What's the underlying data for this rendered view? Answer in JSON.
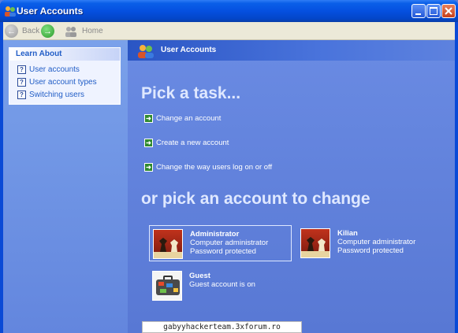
{
  "window": {
    "title": "User Accounts",
    "buttons": {
      "minimize": "minimize",
      "maximize": "maximize",
      "close": "close"
    }
  },
  "toolbar": {
    "back_label": "Back",
    "home_label": "Home"
  },
  "sidebar": {
    "heading": "Learn About",
    "items": [
      {
        "label": "User accounts"
      },
      {
        "label": "User account types"
      },
      {
        "label": "Switching users"
      }
    ]
  },
  "main": {
    "header_title": "User Accounts",
    "pick_task": "Pick a task...",
    "tasks": [
      {
        "label": "Change an account"
      },
      {
        "label": "Create a new account"
      },
      {
        "label": "Change the way users log on or off"
      }
    ],
    "pick_account": "or pick an account to change",
    "accounts": [
      {
        "name": "Administrator",
        "type": "Computer administrator",
        "status": "Password protected",
        "picture": "chess-icon"
      },
      {
        "name": "Kilian",
        "type": "Computer administrator",
        "status": "Password protected",
        "picture": "chess-icon"
      },
      {
        "name": "Guest",
        "type": "Guest account is on",
        "status": "",
        "picture": "suitcase-icon"
      }
    ]
  },
  "url_overlay": "gabyyhackerteam.3xforum.ro",
  "colors": {
    "titlebar": "#0550e0",
    "sidebar": "#7aa1ea",
    "main_bg": "#6a8be3",
    "link": "#215dc6",
    "task_arrow": "#2f8a2f"
  }
}
